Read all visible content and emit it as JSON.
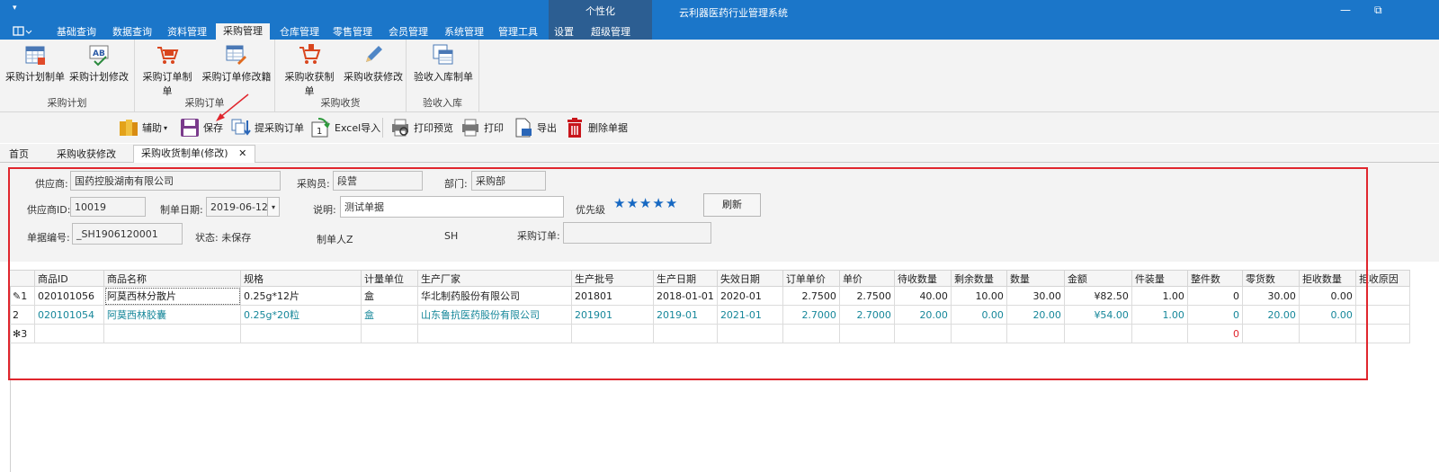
{
  "titlebar": {
    "quick_access": "▾",
    "context_title": "个性化",
    "app_title": "云利器医药行业管理系统",
    "minimize": "—",
    "restore": "⧉"
  },
  "ribbon_tabs": [
    "基础查询",
    "数据查询",
    "资料管理",
    "采购管理",
    "仓库管理",
    "零售管理",
    "会员管理",
    "系统管理",
    "管理工具",
    "设置",
    "超级管理"
  ],
  "ribbon_groups": [
    {
      "label": "采购计划",
      "buttons": [
        "采购计划制单",
        "采购计划修改"
      ]
    },
    {
      "label": "采购订单",
      "buttons": [
        "采购订单制单",
        "采购订单修改籍"
      ]
    },
    {
      "label": "采购收货",
      "buttons": [
        "采购收获制单",
        "采购收获修改"
      ]
    },
    {
      "label": "验收入库",
      "buttons": [
        "验收入库制单"
      ]
    }
  ],
  "toolbar": {
    "assist": "辅助",
    "save": "保存",
    "fetch_order": "提采购订单",
    "excel_import": "Excel导入",
    "print_preview": "打印预览",
    "print": "打印",
    "export": "导出",
    "delete": "删除单据"
  },
  "doc_tabs": {
    "home": "首页",
    "recv_edit": "采购收获修改",
    "active": "采购收货制单(修改)",
    "close": "✕"
  },
  "form": {
    "supplier_label": "供应商:",
    "supplier_value": "国药控股湖南有限公司",
    "buyer_label": "采购员:",
    "buyer_value": "段营",
    "dept_label": "部门:",
    "dept_value": "采购部",
    "supplier_id_label": "供应商ID:",
    "supplier_id_value": "10019",
    "date_label": "制单日期:",
    "date_value": "2019-06-12",
    "note_label": "说明:",
    "note_value": "测试单据",
    "priority_label": "优先级",
    "priority_stars": 5,
    "refresh": "刷新",
    "docno_label": "单据编号:",
    "docno_value": "_SH1906120001",
    "status": "状态: 未保存",
    "maker": "制单人Z",
    "sh": "SH",
    "po_label": "采购订单:",
    "po_value": ""
  },
  "grid": {
    "columns": [
      "商品ID",
      "商品名称",
      "规格",
      "计量单位",
      "生产厂家",
      "生产批号",
      "生产日期",
      "失效日期",
      "订单单价",
      "单价",
      "待收数量",
      "剩余数量",
      "数量",
      "金额",
      "件装量",
      "整件数",
      "零货数",
      "拒收数量",
      "拒收原因"
    ],
    "rows": [
      {
        "ind": "✎1",
        "cells": [
          "020101056",
          "阿莫西林分散片",
          "0.25g*12片",
          "盒",
          "华北制药股份有限公司",
          "201801",
          "2018-01-01",
          "2020-01",
          "2.7500",
          "2.7500",
          "40.00",
          "10.00",
          "30.00",
          "¥82.50",
          "1.00",
          "0",
          "30.00",
          "0.00",
          ""
        ]
      },
      {
        "ind": "2",
        "cells": [
          "020101054",
          "阿莫西林胶囊",
          "0.25g*20粒",
          "盒",
          "山东鲁抗医药股份有限公司",
          "201901",
          "2019-01",
          "2021-01",
          "2.7000",
          "2.7000",
          "20.00",
          "0.00",
          "20.00",
          "¥54.00",
          "1.00",
          "0",
          "20.00",
          "0.00",
          ""
        ]
      },
      {
        "ind": "✻3",
        "cells": [
          "",
          "",
          "",
          "",
          "",
          "",
          "",
          "",
          "",
          "",
          "",
          "",
          "",
          "",
          "",
          "0",
          "",
          "",
          ""
        ]
      }
    ]
  },
  "colors": {
    "title_blue": "#1b76c9",
    "highlight_red": "#e0262d",
    "selected_text": "#16879a",
    "star_blue": "#1668c2"
  }
}
